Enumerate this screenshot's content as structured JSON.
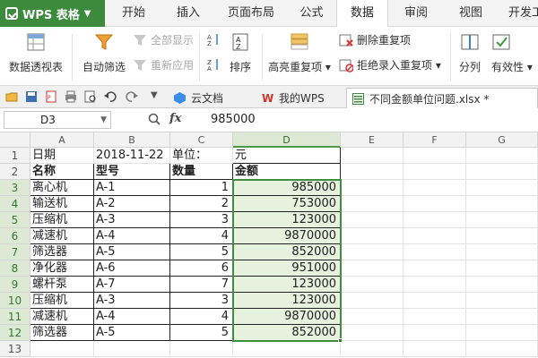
{
  "app": {
    "name": "WPS 表格",
    "menu_tabs": [
      "开始",
      "插入",
      "页面布局",
      "公式",
      "数据",
      "审阅",
      "视图",
      "开发工"
    ],
    "active_tab": "数据"
  },
  "ribbon": {
    "pivot_table": "数据透视表",
    "auto_filter": "自动筛选",
    "show_all": "全部显示",
    "reapply": "重新应用",
    "sort": "排序",
    "highlight_dup": "高亮重复项",
    "delete_dup": "删除重复项",
    "reject_dup": "拒绝录入重复项",
    "split": "分列",
    "validity": "有效性"
  },
  "doc_tabs": [
    {
      "label": "云文档"
    },
    {
      "label": "我的WPS"
    },
    {
      "label": "不同金额单位问题.xlsx *"
    }
  ],
  "formula_bar": {
    "name_box": "D3",
    "fx": "fx",
    "value": "985000"
  },
  "columns": [
    "A",
    "B",
    "C",
    "D",
    "E",
    "F",
    "G"
  ],
  "rows": [
    "1",
    "2",
    "3",
    "4",
    "5",
    "6",
    "7",
    "8",
    "9",
    "10",
    "11",
    "12",
    "13"
  ],
  "sheet": {
    "r1": {
      "a": "日期",
      "b": "2018-11-22",
      "c": "单位：",
      "d": "元"
    },
    "headers": {
      "a": "名称",
      "b": "型号",
      "c": "数量",
      "d": "金额"
    },
    "data": [
      {
        "name": "离心机",
        "model": "A-1",
        "qty": "1",
        "amount": "985000"
      },
      {
        "name": "输送机",
        "model": "A-2",
        "qty": "2",
        "amount": "753000"
      },
      {
        "name": "压缩机",
        "model": "A-3",
        "qty": "3",
        "amount": "123000"
      },
      {
        "name": "减速机",
        "model": "A-4",
        "qty": "4",
        "amount": "9870000"
      },
      {
        "name": "筛选器",
        "model": "A-5",
        "qty": "5",
        "amount": "852000"
      },
      {
        "name": "净化器",
        "model": "A-6",
        "qty": "6",
        "amount": "951000"
      },
      {
        "name": "螺杆泵",
        "model": "A-7",
        "qty": "7",
        "amount": "123000"
      },
      {
        "name": "压缩机",
        "model": "A-3",
        "qty": "3",
        "amount": "123000"
      },
      {
        "name": "减速机",
        "model": "A-4",
        "qty": "4",
        "amount": "9870000"
      },
      {
        "name": "筛选器",
        "model": "A-5",
        "qty": "5",
        "amount": "852000"
      }
    ]
  },
  "colors": {
    "accent": "#3c8b3c",
    "selection": "#e6f1de",
    "selection_border": "#3e8e3e"
  }
}
